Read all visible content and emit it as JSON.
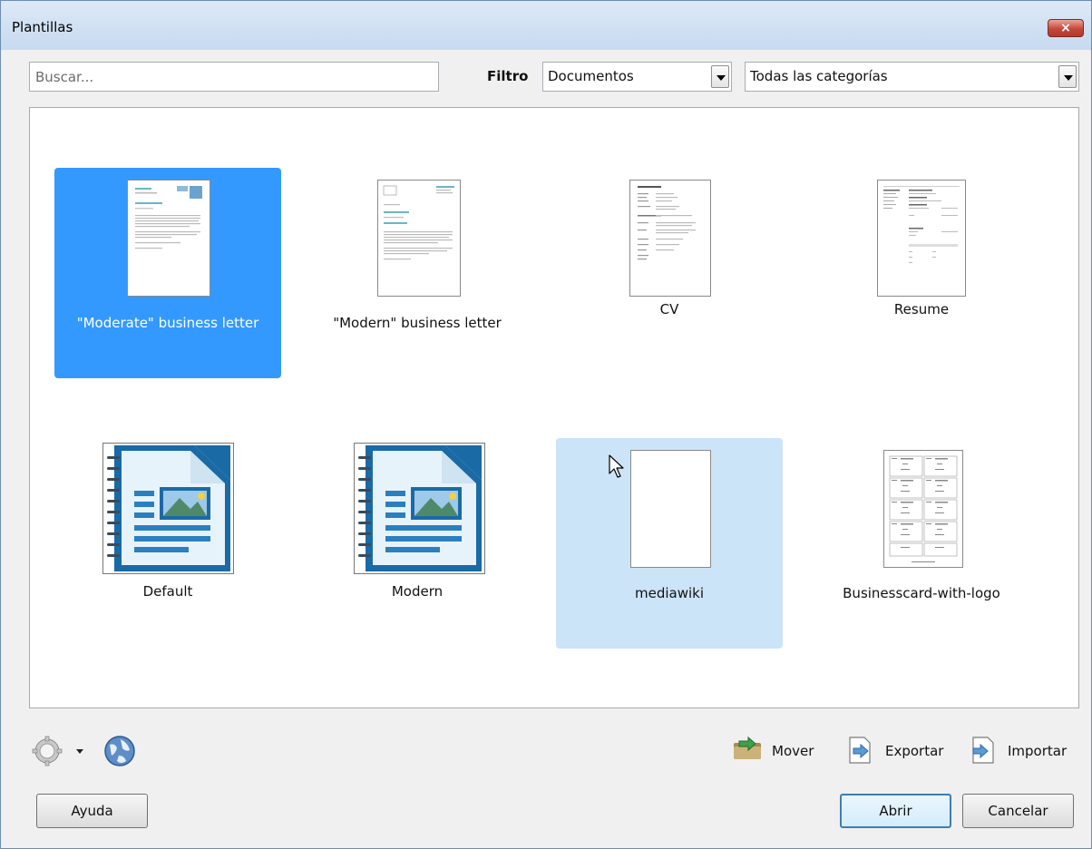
{
  "window": {
    "title": "Plantillas",
    "close_glyph": "×"
  },
  "search": {
    "placeholder": "Buscar...",
    "value": ""
  },
  "filter": {
    "label": "Filtro",
    "type_value": "Documentos",
    "category_value": "Todas las categorías"
  },
  "templates": [
    {
      "name": "\"Moderate\" business letter",
      "state": "selected",
      "thumbnail": "letter-thumbnail"
    },
    {
      "name": "\"Modern\" business letter",
      "state": "normal",
      "thumbnail": "letter-thumbnail"
    },
    {
      "name": "CV",
      "state": "normal",
      "thumbnail": "cv-thumbnail"
    },
    {
      "name": "Resume",
      "state": "normal",
      "thumbnail": "resume-thumbnail"
    },
    {
      "name": "Default",
      "state": "normal",
      "thumbnail": "writer-document-icon"
    },
    {
      "name": "Modern",
      "state": "normal",
      "thumbnail": "writer-document-icon"
    },
    {
      "name": "mediawiki",
      "state": "hover",
      "thumbnail": "blank-page"
    },
    {
      "name": "Businesscard-with-logo",
      "state": "normal",
      "thumbnail": "businesscard-thumbnail"
    }
  ],
  "toolbar": {
    "settings_icon": "gear-icon",
    "settings_dropdown_icon": "dropdown-arrow-icon",
    "online_icon": "globe-icon",
    "move_label": "Mover",
    "export_label": "Exportar",
    "import_label": "Importar"
  },
  "buttons": {
    "help_label": "Ayuda",
    "open_label": "Abrir",
    "cancel_label": "Cancelar"
  },
  "colors": {
    "selected": "#3399ff",
    "hover": "#cce4f7",
    "accent_text": "#2c9bb5",
    "writer_blue": "#1a6aa6"
  }
}
